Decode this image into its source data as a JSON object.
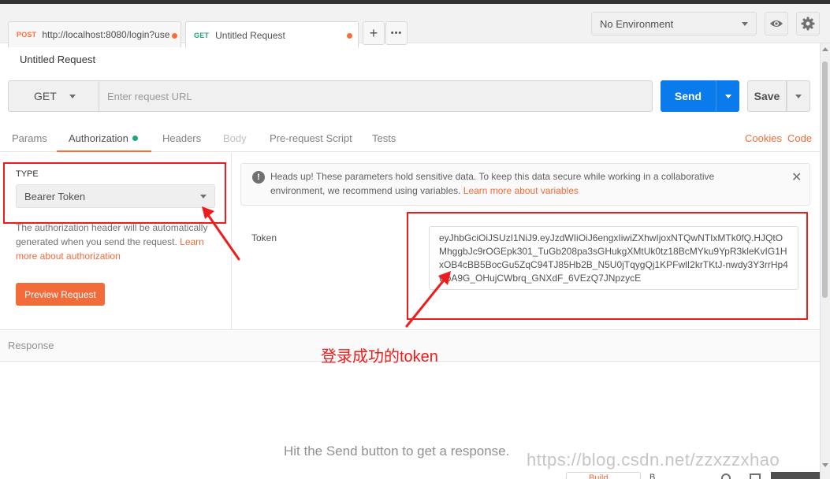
{
  "tabs": [
    {
      "method": "POST",
      "label": "http://localhost:8080/login?use",
      "active": false
    },
    {
      "method": "GET",
      "label": "Untitled Request",
      "active": true
    }
  ],
  "tab_actions": {
    "new_tab": "+",
    "more": "•••"
  },
  "environment": {
    "selected": "No Environment"
  },
  "request": {
    "title": "Untitled Request",
    "method": "GET",
    "url_placeholder": "Enter request URL",
    "send_label": "Send",
    "save_label": "Save"
  },
  "subtabs": {
    "items": [
      "Params",
      "Authorization",
      "Headers",
      "Body",
      "Pre-request Script",
      "Tests"
    ],
    "active": "Authorization",
    "links": [
      "Cookies",
      "Code"
    ]
  },
  "auth": {
    "type_label": "TYPE",
    "type_value": "Bearer Token",
    "description": "The authorization header will be automatically generated when you send the request. ",
    "description_link": "Learn more about authorization",
    "preview_button": "Preview Request"
  },
  "alert": {
    "text": "Heads up! These parameters hold sensitive data. To keep this data secure while working in a collaborative environment, we recommend using variables. ",
    "link": "Learn more about variables",
    "close": "✕"
  },
  "token": {
    "label": "Token",
    "value": "eyJhbGciOiJSUzI1NiJ9.eyJzdWIiOiJ6engxIiwiZXhwIjoxNTQwNTIxMTk0fQ.HJQtOMhggbJc9rOGEpk301_TuGb208pa3sGHukgXMtUk0tz18BcMYku9YpR3kleKvIG1HxOB4cBB5BocGu5ZqC94TJ85Hb2B_N5U0jTqygQj1KPFwlI2krTKtJ-nwdy3Y3rrHp4woA9G_OHujCWbrq_GNXdF_6VEzQ7JNpzycE"
  },
  "response": {
    "label": "Response",
    "hint": "Hit the Send button to get a response."
  },
  "statusbar": {
    "build": "Build",
    "browse": "B"
  },
  "annotation": {
    "caption": "登录成功的token"
  },
  "watermark": "https://blog.csdn.net/zzxzzxhao",
  "colors": {
    "accent_orange": "#ff6c37",
    "send_blue": "#097bed",
    "annotation_red": "#ee1c1c",
    "get_green": "#1fa47c"
  }
}
